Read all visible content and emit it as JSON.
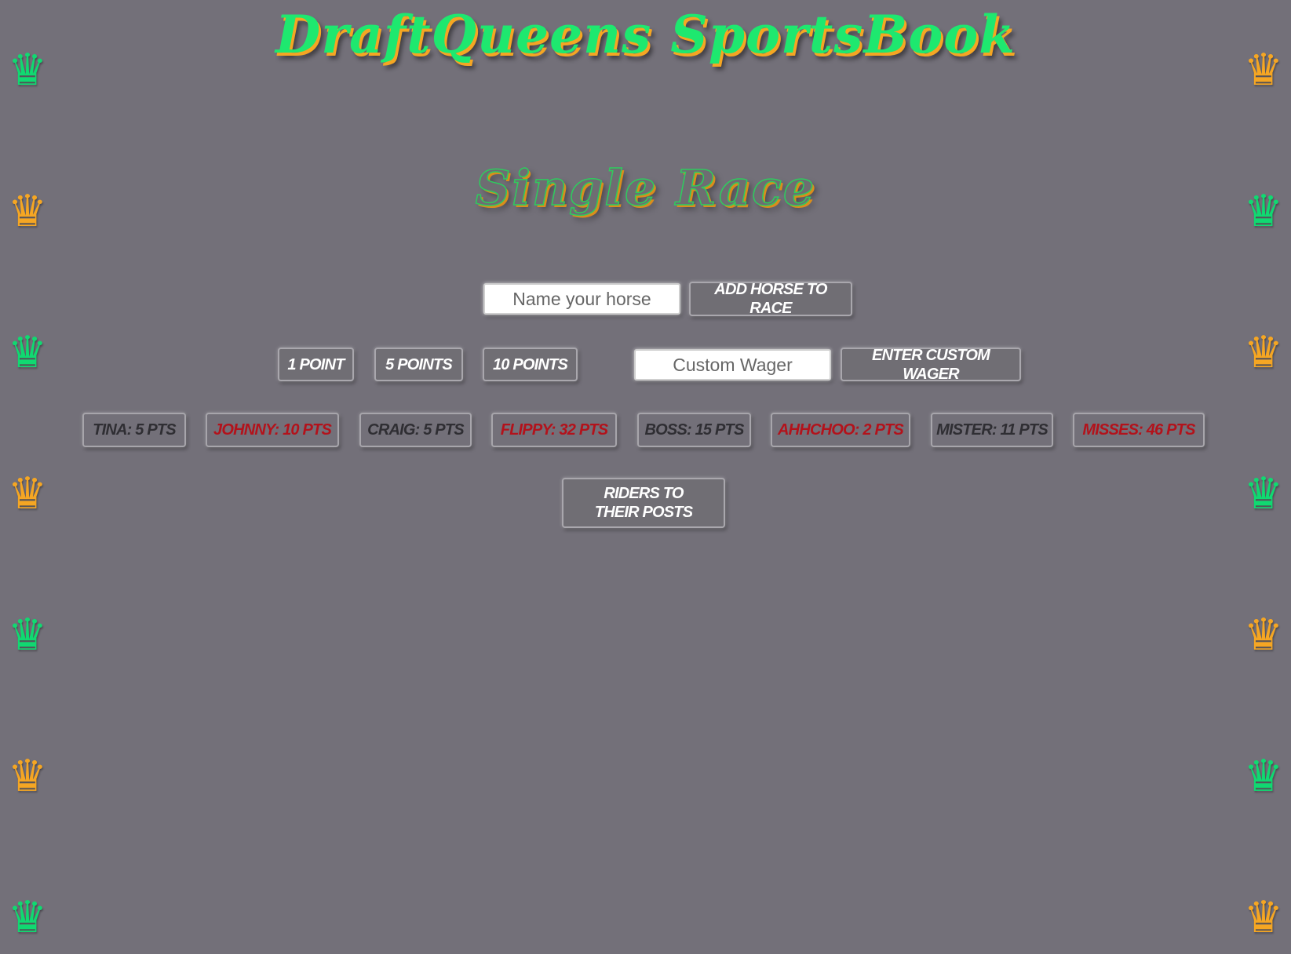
{
  "header": {
    "title": "DraftQueens SportsBook",
    "subtitle": "Single Race"
  },
  "decor": {
    "crown_icon": "♛",
    "colors": {
      "green": "#10d971",
      "orange": "#f5a623"
    }
  },
  "horse_entry": {
    "placeholder": "Name your horse",
    "add_label": "Add Horse to Race"
  },
  "wagers": {
    "one_label": "1 Point",
    "five_label": "5 Points",
    "ten_label": "10 Points",
    "custom_placeholder": "Custom Wager",
    "custom_label": "Enter Custom Wager"
  },
  "bettors": [
    {
      "label": "Tina: 5 pts",
      "color": "#2f2e33"
    },
    {
      "label": "Johnny: 10 pts",
      "color": "#b3121b"
    },
    {
      "label": "Craig: 5 pts",
      "color": "#2f2e33"
    },
    {
      "label": "Flippy: 32 pts",
      "color": "#b3121b"
    },
    {
      "label": "Boss: 15 pts",
      "color": "#2f2e33"
    },
    {
      "label": "Ahhchoo: 2 pts",
      "color": "#b3121b"
    },
    {
      "label": "Mister: 11 pts",
      "color": "#2f2e33"
    },
    {
      "label": "Misses: 46 pts",
      "color": "#b3121b"
    }
  ],
  "start": {
    "label": "Riders to their posts"
  }
}
